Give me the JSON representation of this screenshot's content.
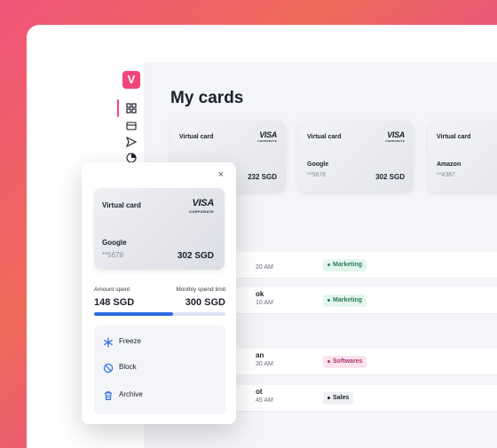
{
  "app": {
    "logo_letter": "V"
  },
  "page": {
    "title": "My cards"
  },
  "cards": [
    {
      "label": "Virtual card",
      "brand": "VISA",
      "brand_sub": "CORPORATE",
      "merchant": "",
      "number": "",
      "amount": "232 SGD"
    },
    {
      "label": "Virtual card",
      "brand": "VISA",
      "brand_sub": "CORPORATE",
      "merchant": "Google",
      "number": "**5678",
      "amount": "302 SGD"
    },
    {
      "label": "Virtual card",
      "brand": "VISA",
      "brand_sub": "CORPORATE",
      "merchant": "Amazon",
      "number": "**4367",
      "amount": ""
    }
  ],
  "transactions": [
    {
      "name": "",
      "time": "20 AM",
      "tag": "Marketing"
    },
    {
      "name": "ok",
      "time": "10 AM",
      "tag": "Marketing"
    },
    {
      "name": "an",
      "time": "30 AM",
      "tag": "Softwares"
    },
    {
      "name": "ot",
      "time": "45 AM",
      "tag": "Sales"
    }
  ],
  "detail": {
    "card": {
      "label": "Virtual card",
      "brand": "VISA",
      "brand_sub": "CORPORATE",
      "merchant": "Google",
      "number": "**5678",
      "amount": "302 SGD"
    },
    "amount_spent_label": "Amount spent",
    "limit_label": "Monthly spend limit",
    "amount_spent": "148 SGD",
    "limit": "300 SGD",
    "progress_fraction": 0.6,
    "actions": [
      {
        "label": "Freeze",
        "icon": "snowflake-icon"
      },
      {
        "label": "Block",
        "icon": "block-icon"
      },
      {
        "label": "Archive",
        "icon": "trash-icon"
      }
    ]
  },
  "colors": {
    "accent": "#f0457a",
    "progress": "#2a6be0",
    "tag_marketing_bg": "#e3f6ee",
    "tag_marketing_fg": "#2f7a5a",
    "tag_software_bg": "#fbe3ee",
    "tag_software_fg": "#b0306a",
    "tag_sales_bg": "#eef0f4",
    "tag_sales_fg": "#1d1f2b"
  }
}
